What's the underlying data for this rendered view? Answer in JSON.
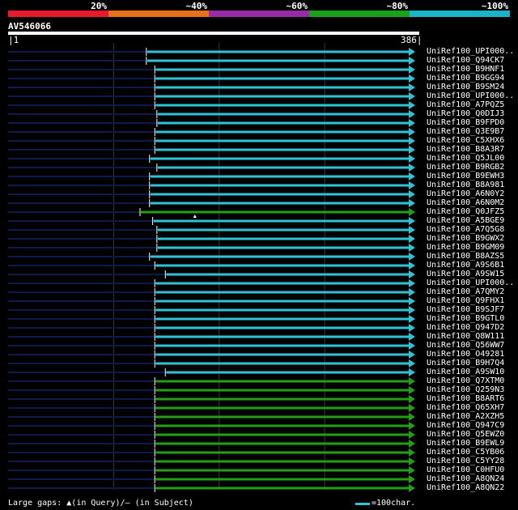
{
  "legend": [
    {
      "label": "20%",
      "color": "#e8192c"
    },
    {
      "label": "~40%",
      "color": "#e8701a"
    },
    {
      "label": "~60%",
      "color": "#9b2aa8"
    },
    {
      "label": "~80%",
      "color": "#1aa11a"
    },
    {
      "label": "~100%",
      "color": "#1ab4c8"
    }
  ],
  "query": {
    "name": "AV546066",
    "start_label": "1",
    "end_label": "386",
    "length": 386
  },
  "colors": {
    "identity_high": "#2ec4d8",
    "identity_80": "#22a012",
    "gap_line": "#101a4a",
    "grid": "#3a3a3a",
    "query_bar": "#ffffff"
  },
  "hits": [
    {
      "name": "UniRef100_UPI000..",
      "start": 132,
      "color": "high"
    },
    {
      "name": "UniRef100_Q94CK7",
      "start": 132,
      "color": "high"
    },
    {
      "name": "UniRef100_B9HNF1",
      "start": 140,
      "color": "high"
    },
    {
      "name": "UniRef100_B9GG94",
      "start": 140,
      "color": "high"
    },
    {
      "name": "UniRef100_B9SM24",
      "start": 140,
      "color": "high"
    },
    {
      "name": "UniRef100_UPI000..",
      "start": 140,
      "color": "high"
    },
    {
      "name": "UniRef100_A7PQZ5",
      "start": 140,
      "color": "high"
    },
    {
      "name": "UniRef100_Q0DIJ3",
      "start": 142,
      "color": "high"
    },
    {
      "name": "UniRef100_B9FPD0",
      "start": 142,
      "color": "high"
    },
    {
      "name": "UniRef100_Q3E9B7",
      "start": 140,
      "color": "high"
    },
    {
      "name": "UniRef100_C5XHX6",
      "start": 140,
      "color": "high"
    },
    {
      "name": "UniRef100_B8A3R7",
      "start": 140,
      "color": "high"
    },
    {
      "name": "UniRef100_Q5JL00",
      "start": 135,
      "color": "high"
    },
    {
      "name": "UniRef100_B9RGB2",
      "start": 142,
      "color": "high"
    },
    {
      "name": "UniRef100_B9EWH3",
      "start": 135,
      "color": "high"
    },
    {
      "name": "UniRef100_B8A981",
      "start": 135,
      "color": "high"
    },
    {
      "name": "UniRef100_A6N0Y2",
      "start": 135,
      "color": "high"
    },
    {
      "name": "UniRef100_A6N0M2",
      "start": 135,
      "color": "high"
    },
    {
      "name": "UniRef100_Q0JFZ5",
      "start": 126,
      "color": "80",
      "gap_marker": 178
    },
    {
      "name": "UniRef100_A5BGE9",
      "start": 138,
      "color": "high"
    },
    {
      "name": "UniRef100_A7Q5G8",
      "start": 142,
      "color": "high"
    },
    {
      "name": "UniRef100_B9GWX2",
      "start": 142,
      "color": "high"
    },
    {
      "name": "UniRef100_B9GM09",
      "start": 142,
      "color": "high"
    },
    {
      "name": "UniRef100_B8AZS5",
      "start": 135,
      "color": "high"
    },
    {
      "name": "UniRef100_A9S6B1",
      "start": 140,
      "color": "high"
    },
    {
      "name": "UniRef100_A9SW15",
      "start": 150,
      "color": "high"
    },
    {
      "name": "UniRef100_UPI000..",
      "start": 140,
      "color": "high"
    },
    {
      "name": "UniRef100_A7QMY2",
      "start": 140,
      "color": "high"
    },
    {
      "name": "UniRef100_Q9FHX1",
      "start": 140,
      "color": "high"
    },
    {
      "name": "UniRef100_B9SJF7",
      "start": 140,
      "color": "high"
    },
    {
      "name": "UniRef100_B9GTL0",
      "start": 140,
      "color": "high"
    },
    {
      "name": "UniRef100_Q947D2",
      "start": 140,
      "color": "high"
    },
    {
      "name": "UniRef100_Q8W111",
      "start": 140,
      "color": "high"
    },
    {
      "name": "UniRef100_Q56WW7",
      "start": 140,
      "color": "high"
    },
    {
      "name": "UniRef100_O49281",
      "start": 140,
      "color": "high"
    },
    {
      "name": "UniRef100_B9H7Q4",
      "start": 140,
      "color": "high"
    },
    {
      "name": "UniRef100_A9SW10",
      "start": 150,
      "color": "high"
    },
    {
      "name": "UniRef100_Q7XTM0",
      "start": 140,
      "color": "80"
    },
    {
      "name": "UniRef100_Q259N3",
      "start": 140,
      "color": "80"
    },
    {
      "name": "UniRef100_B8ART6",
      "start": 140,
      "color": "80"
    },
    {
      "name": "UniRef100_Q65XH7",
      "start": 140,
      "color": "80"
    },
    {
      "name": "UniRef100_A2XZH5",
      "start": 140,
      "color": "80"
    },
    {
      "name": "UniRef100_Q947C9",
      "start": 140,
      "color": "80"
    },
    {
      "name": "UniRef100_Q5EWZ0",
      "start": 140,
      "color": "80"
    },
    {
      "name": "UniRef100_B9EWL9",
      "start": 140,
      "color": "80"
    },
    {
      "name": "UniRef100_C5YB06",
      "start": 140,
      "color": "80"
    },
    {
      "name": "UniRef100_C5YY28",
      "start": 140,
      "color": "80"
    },
    {
      "name": "UniRef100_C0HFU0",
      "start": 140,
      "color": "80"
    },
    {
      "name": "UniRef100_A8QN24",
      "start": 140,
      "color": "80"
    },
    {
      "name": "UniRef100_A8QN22",
      "start": 140,
      "color": "80"
    }
  ],
  "footer": {
    "large_gaps_text": "Large gaps:",
    "query_gap_text": "(in Query)/",
    "subject_gap_text": "(in Subject)",
    "scale_text": "=100char."
  }
}
